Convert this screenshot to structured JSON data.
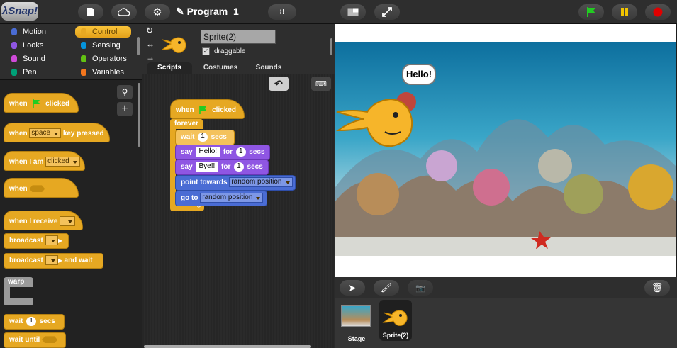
{
  "app": {
    "logo": "λSnap!",
    "project_title": "✎ Program_1"
  },
  "categories": [
    {
      "label": "Motion",
      "color": "#4a6cd4"
    },
    {
      "label": "Control",
      "color": "#e6a822",
      "selected": true
    },
    {
      "label": "Looks",
      "color": "#8f56e3"
    },
    {
      "label": "Sensing",
      "color": "#0494dc"
    },
    {
      "label": "Sound",
      "color": "#cf4ad9"
    },
    {
      "label": "Operators",
      "color": "#62c213"
    },
    {
      "label": "Pen",
      "color": "#00a178"
    },
    {
      "label": "Variables",
      "color": "#f3761d"
    }
  ],
  "palette": {
    "when_flag": {
      "a": "when",
      "b": "clicked"
    },
    "when_key": {
      "a": "when",
      "key": "space",
      "b": "key pressed"
    },
    "when_iam": {
      "a": "when",
      "b": "I",
      "c": "am",
      "val": "clicked"
    },
    "when_cond": {
      "a": "when"
    },
    "when_receive": {
      "a": "when",
      "b": "I",
      "c": "receive"
    },
    "broadcast": {
      "a": "broadcast"
    },
    "broadcast_wait": {
      "a": "broadcast",
      "b": "and",
      "c": "wait"
    },
    "warp": {
      "a": "warp"
    },
    "wait": {
      "a": "wait",
      "val": "1",
      "b": "secs"
    },
    "wait_until": {
      "a": "wait",
      "b": "until"
    }
  },
  "sprite": {
    "name": "Sprite(2)",
    "draggable_label": "draggable",
    "draggable_check": "✓"
  },
  "tabs": [
    "Scripts",
    "Costumes",
    "Sounds"
  ],
  "script": {
    "hat": {
      "a": "when",
      "b": "clicked"
    },
    "forever": "forever",
    "wait": {
      "a": "wait",
      "val": "1",
      "b": "secs"
    },
    "say1": {
      "a": "say",
      "val": "Hello!",
      "b": "for",
      "num": "1",
      "c": "secs"
    },
    "say2": {
      "a": "say",
      "val": "Bye!!",
      "b": "for",
      "num": "1",
      "c": "secs"
    },
    "point": {
      "a": "point",
      "b": "towards",
      "val": "random position"
    },
    "goto": {
      "a": "go",
      "b": "to",
      "val": "random position"
    }
  },
  "stage": {
    "speech": "Hello!"
  },
  "corral": {
    "stage_label": "Stage",
    "sprite_label": "Sprite(2)"
  },
  "colors": {
    "control": "#e6a822",
    "motion": "#4a6cd4",
    "looks": "#8f56e3",
    "accent_green": "#22cc22",
    "accent_red": "#e00000",
    "accent_yellow": "#f2c500"
  }
}
